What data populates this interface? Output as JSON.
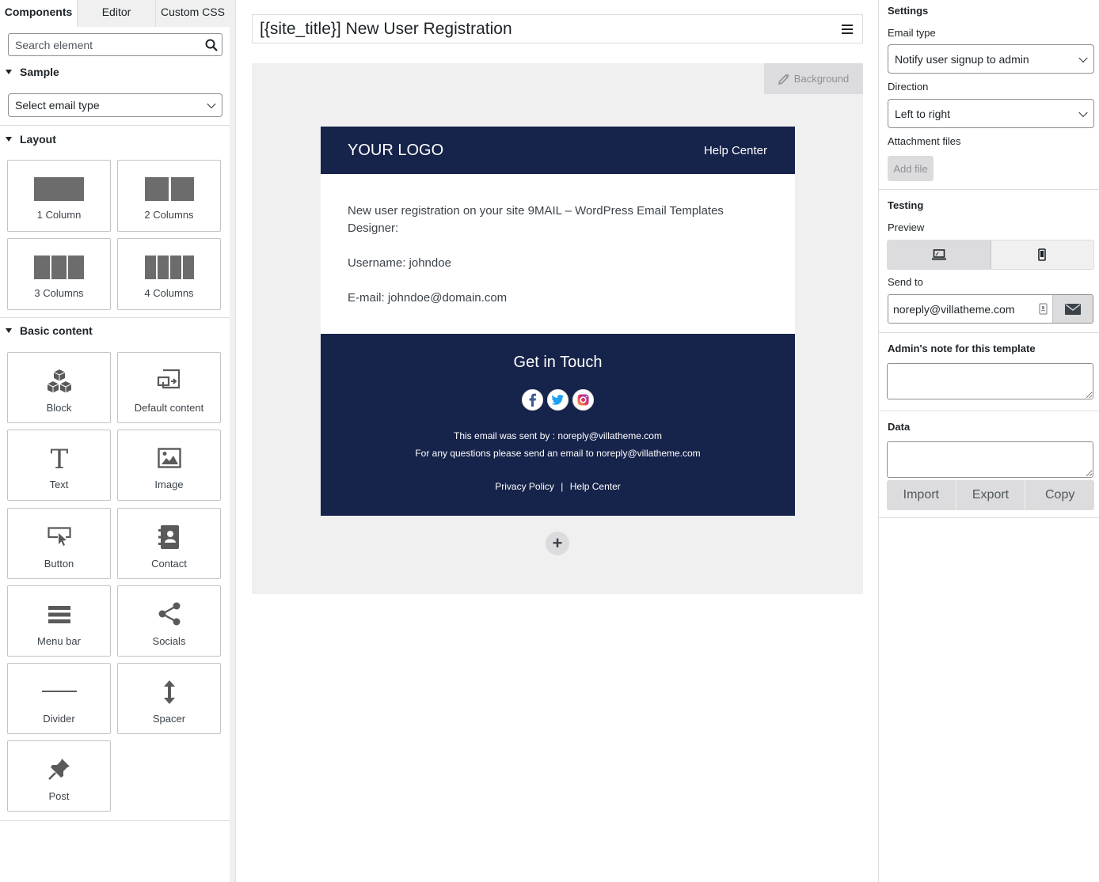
{
  "left": {
    "tabs": [
      {
        "label": "Components"
      },
      {
        "label": "Editor"
      },
      {
        "label": "Custom CSS"
      }
    ],
    "search_placeholder": "Search element",
    "sample": {
      "heading": "Sample",
      "select_value": "Select email type"
    },
    "layout": {
      "heading": "Layout",
      "items": [
        {
          "label": "1 Column"
        },
        {
          "label": "2 Columns"
        },
        {
          "label": "3 Columns"
        },
        {
          "label": "4 Columns"
        }
      ]
    },
    "basic": {
      "heading": "Basic content",
      "items": [
        {
          "label": "Block",
          "icon": "cubes-icon"
        },
        {
          "label": "Default content",
          "icon": "default-content-icon"
        },
        {
          "label": "Text",
          "icon": "text-icon"
        },
        {
          "label": "Image",
          "icon": "image-icon"
        },
        {
          "label": "Button",
          "icon": "button-cursor-icon"
        },
        {
          "label": "Contact",
          "icon": "contact-book-icon"
        },
        {
          "label": "Menu bar",
          "icon": "menu-bars-icon"
        },
        {
          "label": "Socials",
          "icon": "share-icon"
        },
        {
          "label": "Divider",
          "icon": "divider-line-icon"
        },
        {
          "label": "Spacer",
          "icon": "vertical-arrows-icon"
        },
        {
          "label": "Post",
          "icon": "pin-icon"
        }
      ]
    }
  },
  "center": {
    "title": "[{site_title}] New User Registration",
    "background_btn": "Background",
    "email": {
      "logo": "YOUR LOGO",
      "help_center": "Help Center",
      "body_line1": "New user registration on your site 9MAIL – WordPress Email Templates Designer:",
      "body_line2": "Username: johndoe",
      "body_line3": "E-mail: johndoe@domain.com",
      "footer_title": "Get in Touch",
      "sent_by": "This email was sent by : noreply@villatheme.com",
      "questions": "For any questions please send an email to noreply@villatheme.com",
      "privacy": "Privacy Policy",
      "separator": "|",
      "help_center_footer": "Help Center",
      "header_color": "#16234a"
    },
    "add_symbol": "+"
  },
  "right": {
    "settings_heading": "Settings",
    "email_type_label": "Email type",
    "email_type_value": "Notify user signup to admin",
    "direction_label": "Direction",
    "direction_value": "Left to right",
    "attachment_label": "Attachment files",
    "add_file": "Add file",
    "testing_heading": "Testing",
    "preview_label": "Preview",
    "send_to_label": "Send to",
    "send_to_value": "noreply@villatheme.com",
    "admin_note_heading": "Admin's note for this template",
    "data_heading": "Data",
    "import": "Import",
    "export": "Export",
    "copy": "Copy"
  }
}
